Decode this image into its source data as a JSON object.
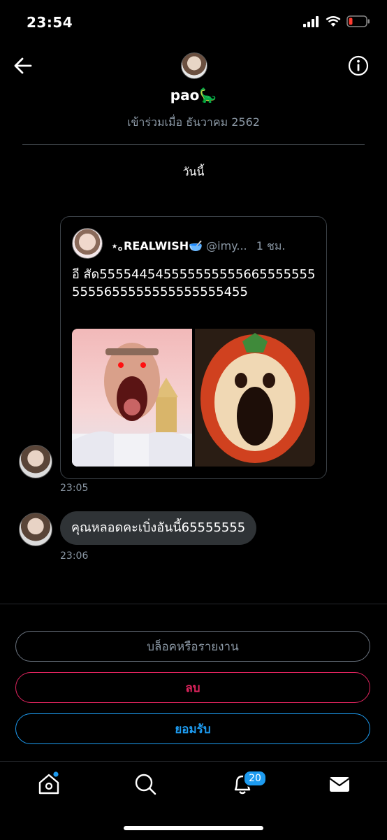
{
  "status_bar": {
    "time": "23:54"
  },
  "header": {
    "name": "pao🦕",
    "joined": "เข้าร่วมเมื่อ ธันวาคม 2562",
    "date_divider": "วันนี้"
  },
  "shared_tweet": {
    "display_name": "⋆｡REALWISH🥣",
    "handle": "@imy...",
    "time_ago": "1 ชม.",
    "text": "อี สัด5555445455555555556655555555555655555555555555455"
  },
  "messages": [
    {
      "time": "23:05"
    },
    {
      "text": "คุณหลอดคะเบิ่งอันนี้65555555",
      "time": "23:06"
    }
  ],
  "actions": {
    "block_report": "บล็อคหรือรายงาน",
    "delete": "ลบ",
    "accept": "ยอมรับ"
  },
  "tabs": {
    "notifications_badge": "20"
  },
  "colors": {
    "accent": "#1d9bf0",
    "danger": "#e0245e",
    "muted": "#8b98a5"
  }
}
